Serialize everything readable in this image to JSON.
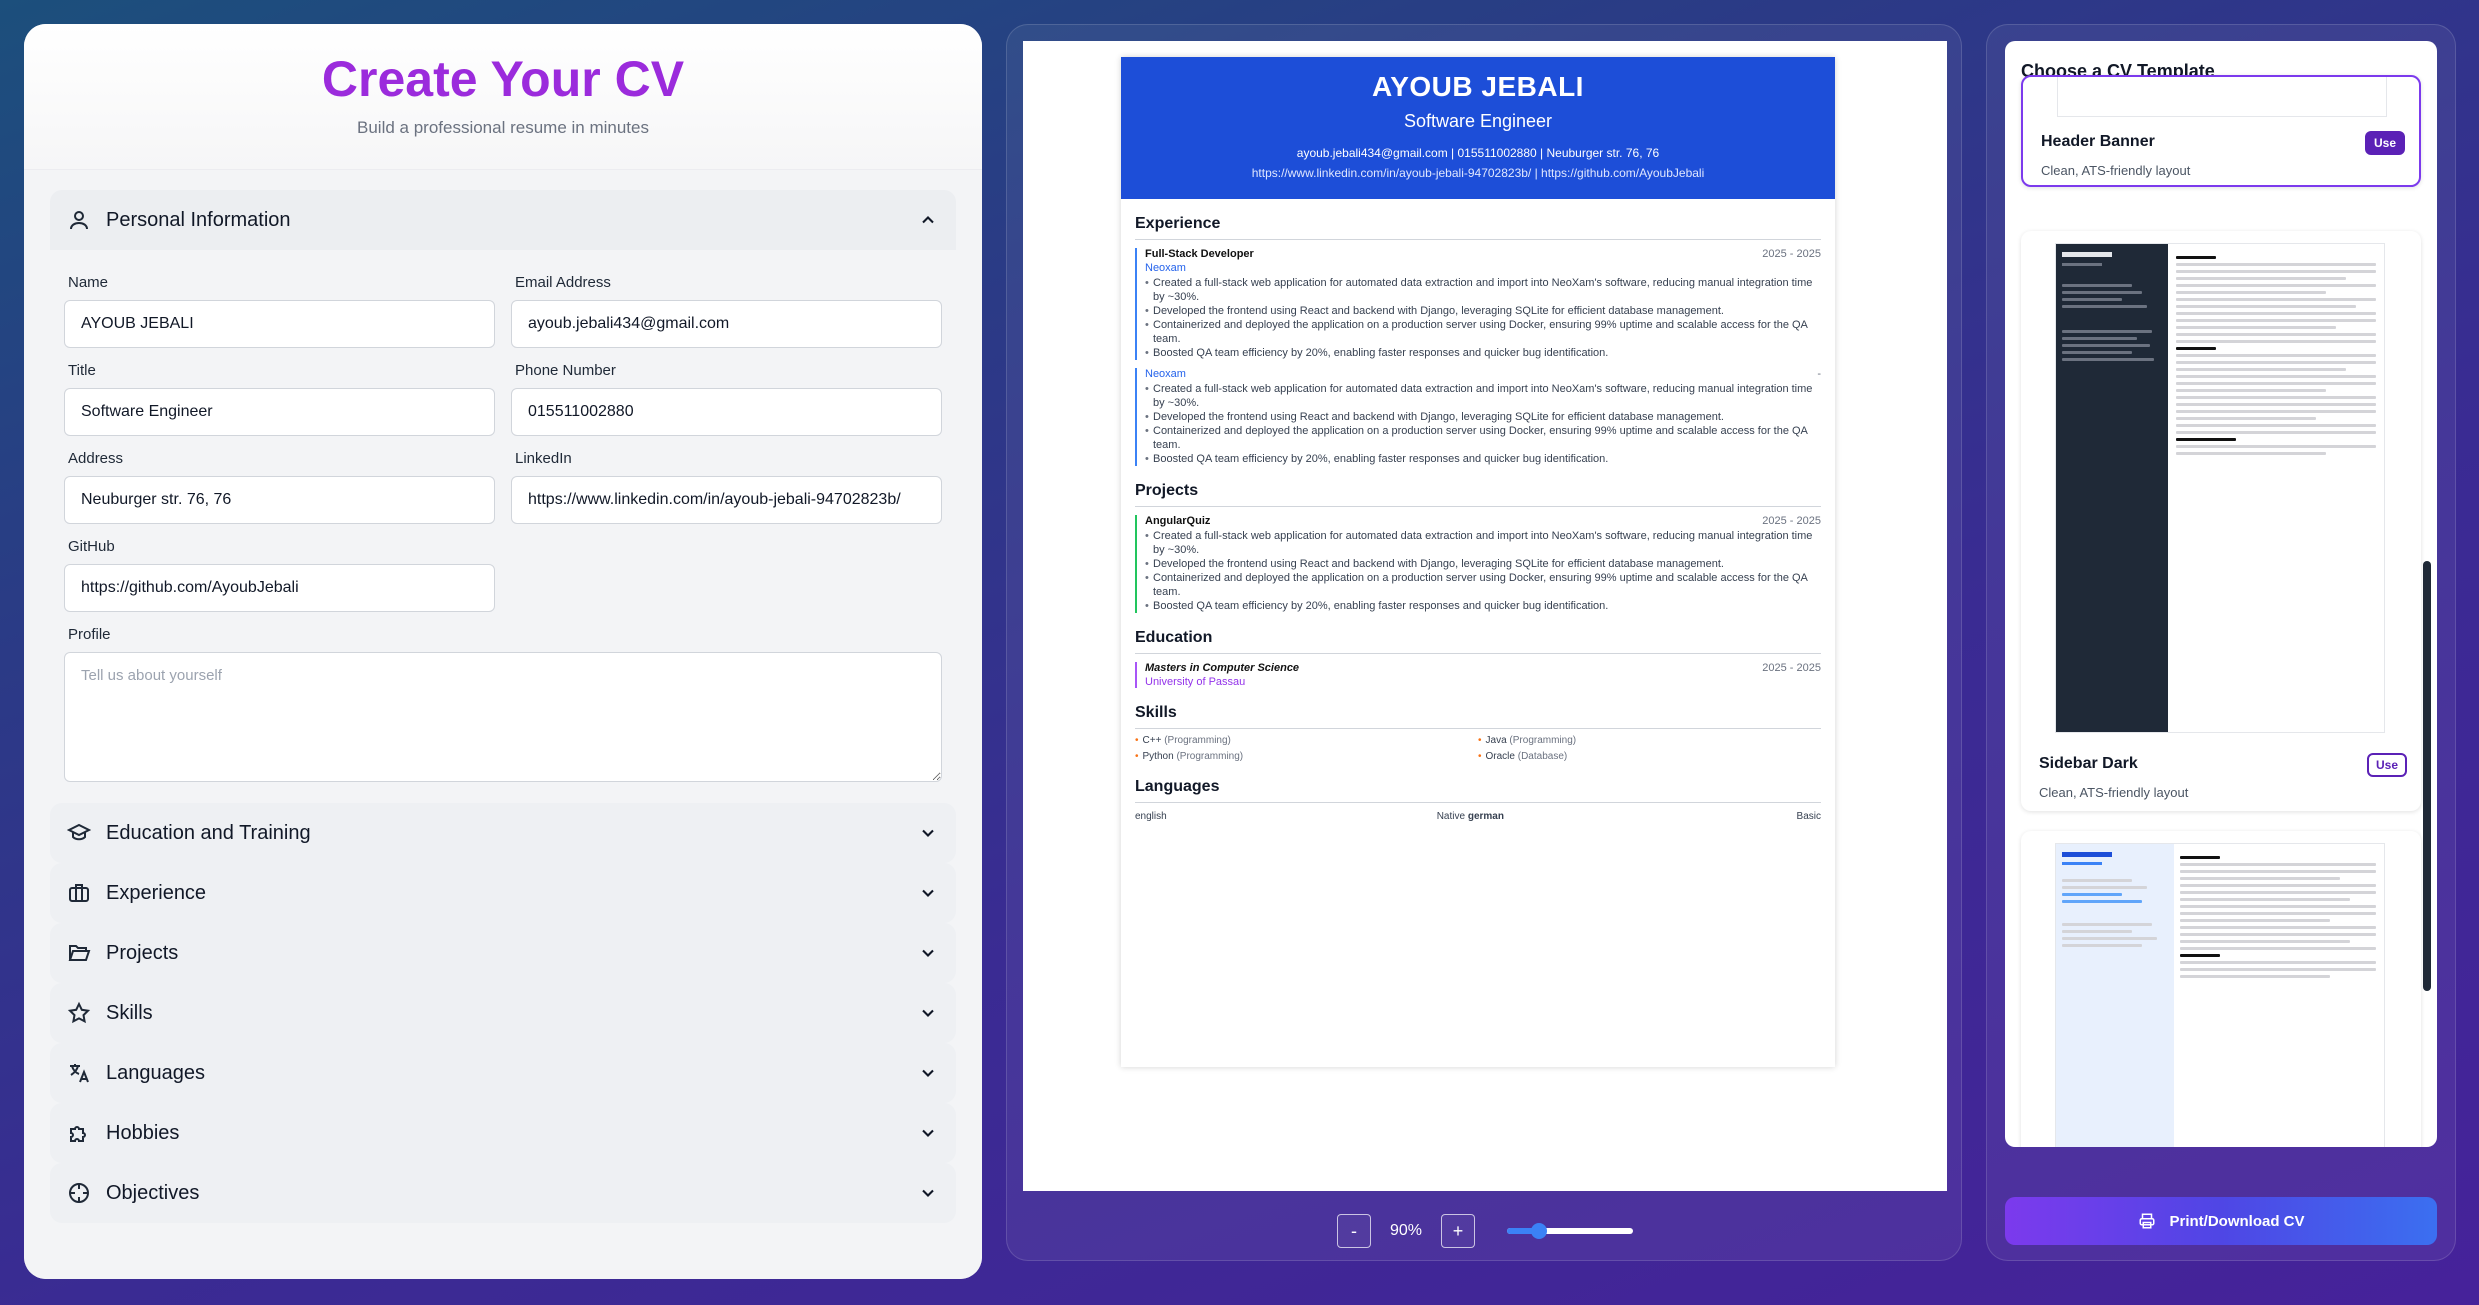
{
  "app": {
    "title": "Create Your CV",
    "subtitle": "Build a professional resume in minutes"
  },
  "personal": {
    "section_title": "Personal Information",
    "fields": {
      "name": {
        "label": "Name",
        "value": "AYOUB JEBALI"
      },
      "email": {
        "label": "Email Address",
        "value": "ayoub.jebali434@gmail.com"
      },
      "title": {
        "label": "Title",
        "value": "Software Engineer"
      },
      "phone": {
        "label": "Phone Number",
        "value": "015511002880"
      },
      "address": {
        "label": "Address",
        "value": "Neuburger str. 76, 76"
      },
      "linkedin": {
        "label": "LinkedIn",
        "value": "https://www.linkedin.com/in/ayoub-jebali-94702823b/"
      },
      "github": {
        "label": "GitHub",
        "value": "https://github.com/AyoubJebali"
      },
      "profile": {
        "label": "Profile",
        "placeholder": "Tell us about yourself"
      }
    }
  },
  "sections": [
    {
      "label": "Education and Training",
      "icon": "graduation-cap-icon"
    },
    {
      "label": "Experience",
      "icon": "briefcase-icon"
    },
    {
      "label": "Projects",
      "icon": "folder-open-icon"
    },
    {
      "label": "Skills",
      "icon": "star-icon"
    },
    {
      "label": "Languages",
      "icon": "translate-icon"
    },
    {
      "label": "Hobbies",
      "icon": "puzzle-icon"
    },
    {
      "label": "Objectives",
      "icon": "target-icon"
    }
  ],
  "preview": {
    "name": "AYOUB JEBALI",
    "title": "Software Engineer",
    "contact": "ayoub.jebali434@gmail.com | 015511002880 | Neuburger str. 76, 76",
    "links": "https://www.linkedin.com/in/ayoub-jebali-94702823b/ | https://github.com/AyoubJebali",
    "experience_heading": "Experience",
    "experience": [
      {
        "role": "Full-Stack Developer",
        "dates": "2025 - 2025",
        "org": "Neoxam",
        "bullets": [
          "Created a full-stack web application for automated data extraction and import into NeoXam's software, reducing manual integration time by ~30%.",
          "Developed the frontend using React and backend with Django, leveraging SQLite for efficient database management.",
          "Containerized and deployed the application on a production server using Docker, ensuring 99% uptime and scalable access for the QA team.",
          "Boosted QA team efficiency by 20%, enabling faster responses and quicker bug identification."
        ]
      },
      {
        "role": "",
        "dates": "-",
        "org": "Neoxam",
        "bullets": [
          "Created a full-stack web application for automated data extraction and import into NeoXam's software, reducing manual integration time by ~30%.",
          "Developed the frontend using React and backend with Django, leveraging SQLite for efficient database management.",
          "Containerized and deployed the application on a production server using Docker, ensuring 99% uptime and scalable access for the QA team.",
          "Boosted QA team efficiency by 20%, enabling faster responses and quicker bug identification."
        ]
      }
    ],
    "projects_heading": "Projects",
    "project": {
      "name": "AngularQuiz",
      "dates": "2025 - 2025",
      "bullets": [
        "Created a full-stack web application for automated data extraction and import into NeoXam's software, reducing manual integration time by ~30%.",
        "Developed the frontend using React and backend with Django, leveraging SQLite for efficient database management.",
        "Containerized and deployed the application on a production server using Docker, ensuring 99% uptime and scalable access for the QA team.",
        "Boosted QA team efficiency by 20%, enabling faster responses and quicker bug identification."
      ]
    },
    "education_heading": "Education",
    "education": {
      "degree": "Masters in Computer Science",
      "school": "University of Passau",
      "dates": "2025 - 2025"
    },
    "skills_heading": "Skills",
    "skills": [
      {
        "name": "C++",
        "cat": "(Programming)"
      },
      {
        "name": "Java",
        "cat": "(Programming)"
      },
      {
        "name": "Python",
        "cat": "(Programming)"
      },
      {
        "name": "Oracle",
        "cat": "(Database)"
      }
    ],
    "languages_heading": "Languages",
    "languages": {
      "lang1": "english",
      "level1": "Native",
      "lang2": "german",
      "level2": "Basic"
    }
  },
  "zoom": {
    "minus": "-",
    "value": "90%",
    "plus": "+",
    "level": 0.25
  },
  "templates": {
    "heading": "Choose a CV Template",
    "items": [
      {
        "name": "Header Banner",
        "desc": "Clean, ATS-friendly layout",
        "button": "Use",
        "selected": true
      },
      {
        "name": "Sidebar Dark",
        "desc": "Clean, ATS-friendly layout",
        "button": "Use",
        "selected": false
      }
    ]
  },
  "print_label": "Print/Download CV"
}
